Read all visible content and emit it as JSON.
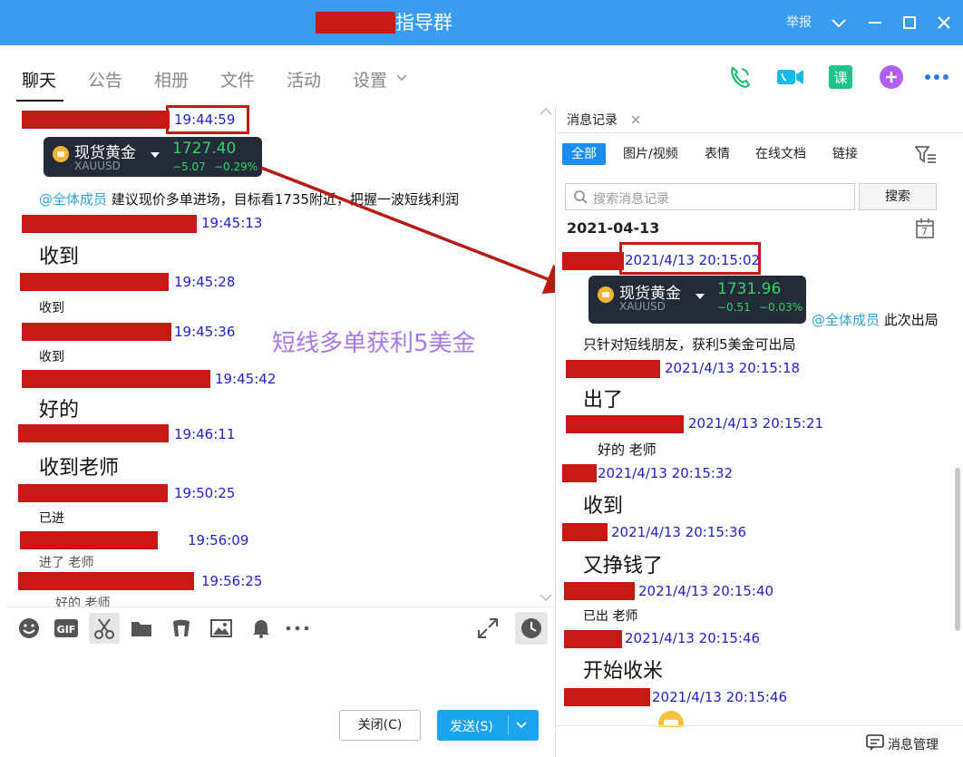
{
  "window": {
    "title": "指导群",
    "report": "举报",
    "controls": [
      "chevron-down",
      "minimize",
      "maximize",
      "close"
    ]
  },
  "tabs": {
    "items": [
      "聊天",
      "公告",
      "相册",
      "文件",
      "活动",
      "设置"
    ],
    "active": "聊天"
  },
  "chat": {
    "annotation": "短线多单获利5美金",
    "messages": [
      {
        "time": "19:44:59"
      },
      {
        "time": "19:45:13",
        "text": "收到"
      },
      {
        "time": "19:45:28",
        "text": "收到"
      },
      {
        "time": "19:45:36",
        "text": "收到"
      },
      {
        "time": "19:45:42",
        "text": "好的"
      },
      {
        "time": "19:46:11",
        "text": "收到老师"
      },
      {
        "time": "19:50:25",
        "text": "已进"
      },
      {
        "time": "19:56:09",
        "text": "进了 老师"
      },
      {
        "time": "19:56:25",
        "text": "好的 老师"
      }
    ],
    "first_card": {
      "name": "现货黄金",
      "symbol": "XAUUSD",
      "price": "1727.40",
      "change": "−5.07",
      "change_pct": "−0.29%"
    },
    "first_mention": "@全体成员",
    "first_text": "建议现价多单进场，目标看1735附近，把握一波短线利润"
  },
  "buttons": {
    "close": "关闭(C)",
    "send": "发送(S)"
  },
  "history": {
    "tab_label": "消息记录",
    "filters": [
      "全部",
      "图片/视频",
      "表情",
      "在线文档",
      "链接"
    ],
    "active_filter": "全部",
    "search_placeholder": "搜索消息记录",
    "search_button": "搜索",
    "date": "2021-04-13",
    "calendar_day": "7",
    "first_time": "2021/4/13 20:15:02",
    "card": {
      "name": "现货黄金",
      "symbol": "XAUUSD",
      "price": "1731.96",
      "change": "−0.51",
      "change_pct": "−0.03%"
    },
    "mention": "@全体成员",
    "mention_text": "此次出局",
    "text_line": "只针对短线朋友，获利5美金可出局",
    "messages": [
      {
        "time": "2021/4/13 20:15:18",
        "text": "出了"
      },
      {
        "time": "2021/4/13 20:15:21",
        "text": "好的 老师"
      },
      {
        "time": "2021/4/13 20:15:32",
        "text": "收到"
      },
      {
        "time": "2021/4/13 20:15:36",
        "text": "又挣钱了"
      },
      {
        "time": "2021/4/13 20:15:40",
        "text": "已出 老师"
      },
      {
        "time": "2021/4/13 20:15:46",
        "text": "开始收米"
      },
      {
        "time": "2021/4/13 20:15:46"
      }
    ],
    "manage": "消息管理"
  }
}
